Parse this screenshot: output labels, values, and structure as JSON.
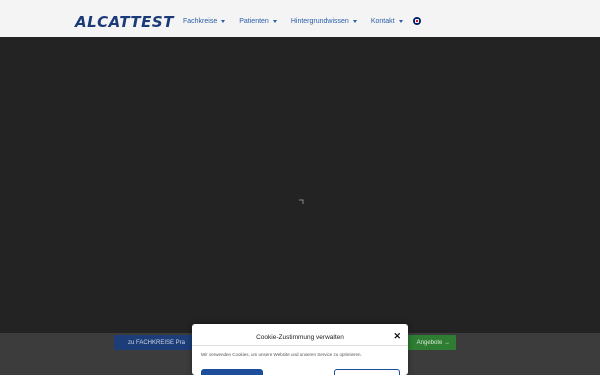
{
  "header": {
    "logo": "ALCATTEST",
    "nav": [
      {
        "label": "Fachkreise"
      },
      {
        "label": "Patienten"
      },
      {
        "label": "Hintergrundwissen"
      },
      {
        "label": "Kontakt"
      }
    ],
    "language_icon": "uk-flag-icon"
  },
  "band": {
    "fachkreise_button": "zu FACHKREISE Pra",
    "angebote_button": "Angebote →"
  },
  "cookie_dialog": {
    "title": "Cookie-Zustimmung verwalten",
    "close_icon": "✕",
    "text": "Wir verwenden Cookies, um unsere Website und unseren Service zu optimieren."
  },
  "colors": {
    "brand": "#1b3a78",
    "nav_link": "#2b5fa8",
    "green_button": "#2e7d32",
    "accept_button": "#1d4e9c"
  }
}
